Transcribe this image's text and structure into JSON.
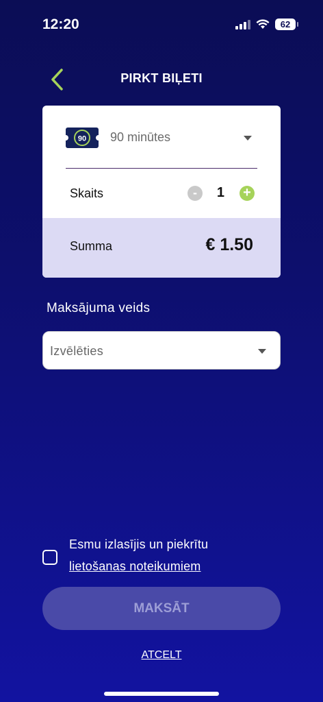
{
  "status_bar": {
    "time": "12:20",
    "battery": "62"
  },
  "header": {
    "title": "PIRKT BIĻETI",
    "back_icon": "chevron-left-icon",
    "accent_color": "#a6d35a"
  },
  "ticket": {
    "icon_label": "90",
    "type_label": "90 minūtes"
  },
  "quantity": {
    "label": "Skaits",
    "minus": "-",
    "value": "1",
    "plus": "+"
  },
  "summary": {
    "label": "Summa",
    "value": "€ 1.50"
  },
  "payment": {
    "label": "Maksājuma veids",
    "placeholder": "Izvēlēties"
  },
  "terms": {
    "text": "Esmu izlasījis un piekrītu",
    "link": "lietošanas noteikumiem"
  },
  "actions": {
    "pay_label": "MAKSĀT",
    "cancel_label": "ATCELT"
  }
}
